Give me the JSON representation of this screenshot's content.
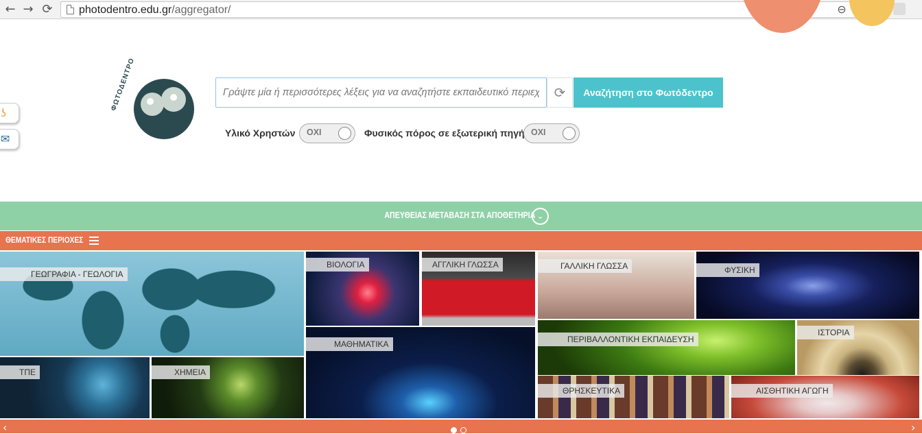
{
  "browser": {
    "url_host": "photodentro.edu.gr",
    "url_path": "/aggregator/",
    "back_icon": "arrow-left-icon",
    "forward_icon": "arrow-right-icon",
    "reload_icon": "reload-icon"
  },
  "logo": {
    "text": "ΦΩΤΟΔΕΝΤΡΟ"
  },
  "search": {
    "placeholder": "Γράψτε μία ή περισσότερες λέξεις για να αναζητήστε εκπαιδευτικό περιεχόμενο",
    "button_label": "Αναζήτηση στο Φωτόδεντρο"
  },
  "filters": [
    {
      "label": "Υλικό Χρηστών",
      "toggle": "ΟΧΙ"
    },
    {
      "label": "Φυσικός πόρος σε εξωτερική πηγή",
      "toggle": "ΟΧΙ"
    }
  ],
  "repositories_banner": "ΑΠΕΥΘΕΙΑΣ ΜΕΤΑΒΑΣΗ ΣΤΑ ΑΠΟΘΕΤΗΡΙΑ",
  "subjects_header": "ΘΕΜΑΤΙΚΕΣ ΠΕΡΙΟΧΕΣ",
  "tiles": {
    "geo": "ΓΕΩΓΡΑΦΙΑ - ΓΕΩΛΟΓΙΑ",
    "tpe": "ΤΠΕ",
    "chem": "ΧΗΜΕΙΑ",
    "bio": "ΒΙΟΛΟΓΙΑ",
    "eng": "ΑΓΓΛΙΚΗ ΓΛΩΣΣΑ",
    "math": "ΜΑΘΗΜΑΤΙΚΑ",
    "fr": "ΓΑΛΛΙΚΗ ΓΛΩΣΣΑ",
    "phys": "ΦΥΣΙΚΗ",
    "env": "ΠΕΡΙΒΑΛΛΟΝΤΙΚΗ ΕΚΠΑΙΔΕΥΣΗ",
    "hist": "ΙΣΤΟΡΙΑ",
    "rel": "ΘΡΗΣΚΕΥΤΙΚΑ",
    "art": "ΑΙΣΘΗΤΙΚΗ ΑΓΩΓΗ"
  },
  "carousel": {
    "pages": 2,
    "current": 1
  }
}
